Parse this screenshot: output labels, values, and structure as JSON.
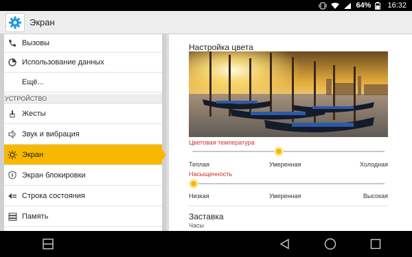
{
  "status": {
    "battery": "64%",
    "time": "16:32"
  },
  "app": {
    "title": "Экран"
  },
  "sidebar": {
    "items": [
      {
        "label": "Вызовы"
      },
      {
        "label": "Использование данных"
      },
      {
        "label": "Ещё..."
      },
      {
        "label": "Жесты"
      },
      {
        "label": "Звук и вибрация"
      },
      {
        "label": "Экран"
      },
      {
        "label": "Экран блокировки"
      },
      {
        "label": "Строка состояния"
      },
      {
        "label": "Память"
      }
    ],
    "section_device": "УСТРОЙСТВО"
  },
  "content": {
    "color_title": "Настройка цвета",
    "temp": {
      "label": "Цветовая температура",
      "left": "Теплая",
      "mid": "Умеренная",
      "right": "Холодная",
      "value": 0.45
    },
    "saturation": {
      "label": "Насыщенность",
      "left": "Низкая",
      "mid": "Умеренная",
      "right": "Высокая",
      "value": 0.0
    },
    "screensaver": {
      "title": "Заставка",
      "subtitle": "Часы"
    }
  },
  "colors": {
    "accent": "#f7b800",
    "label_red": "#d32f2f"
  }
}
